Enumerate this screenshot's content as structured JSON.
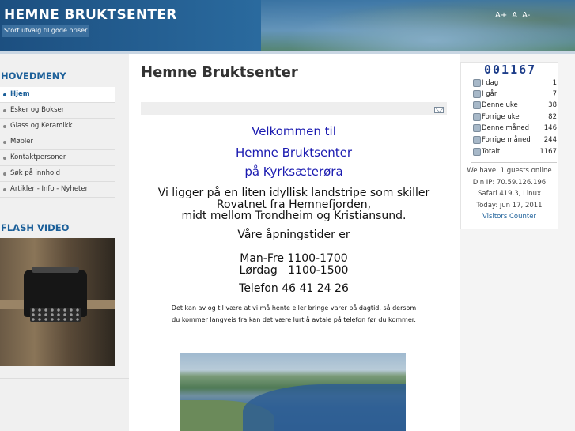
{
  "header": {
    "title": "HEMNE BRUKTSENTER",
    "slogan": "Stort utvalg til gode priser",
    "font_controls": [
      "A+",
      "A",
      "A-"
    ]
  },
  "sidebar": {
    "main_menu_title": "HOVEDMENY",
    "items": [
      {
        "label": "Hjem",
        "active": true
      },
      {
        "label": "Esker og Bokser",
        "active": false
      },
      {
        "label": "Glass og Keramikk",
        "active": false
      },
      {
        "label": "Møbler",
        "active": false
      },
      {
        "label": "Kontaktpersoner",
        "active": false
      },
      {
        "label": "Søk på innhold",
        "active": false
      },
      {
        "label": "Artikler - Info - Nyheter",
        "active": false
      }
    ],
    "video_title": "FLASH VIDEO"
  },
  "main": {
    "page_title": "Hemne Bruktsenter",
    "email_icon": "email-icon",
    "welcome_lines": [
      "Velkommen til",
      "Hemne Bruktsenter",
      "på Kyrksæterøra"
    ],
    "intro": [
      "Vi ligger på en liten idyllisk landstripe som skiller",
      "Rovatnet fra Hemnefjorden,",
      "midt mellom Trondheim og Kristiansund."
    ],
    "hours_heading": "Våre åpningstider er",
    "hours": [
      "Man-Fre 1100-1700",
      "Lørdag   1100-1500"
    ],
    "phone": "Telefon 46 41 24 26",
    "note": [
      "Det kan av og til være at vi må hente eller bringe varer på dagtid, så dersom",
      "du kommer langveis fra kan det være lurt å avtale på telefon før du kommer."
    ]
  },
  "counter": {
    "digits": "001167",
    "stats": [
      {
        "label": "I dag",
        "value": "1"
      },
      {
        "label": "I går",
        "value": "7"
      },
      {
        "label": "Denne uke",
        "value": "38"
      },
      {
        "label": "Forrige uke",
        "value": "82"
      },
      {
        "label": "Denne måned",
        "value": "146"
      },
      {
        "label": "Forrige måned",
        "value": "244"
      },
      {
        "label": "Totalt",
        "value": "1167"
      }
    ],
    "guests": "We have: 1 guests online",
    "ip": "Din IP: 70.59.126.196",
    "browser": "Safari 419.3, Linux",
    "today": "Today: jun 17, 2011",
    "link": "Visitors Counter"
  },
  "colors": {
    "accent": "#1b5f99",
    "welcome": "#1a1ab0",
    "header": "#2a6a9e"
  }
}
